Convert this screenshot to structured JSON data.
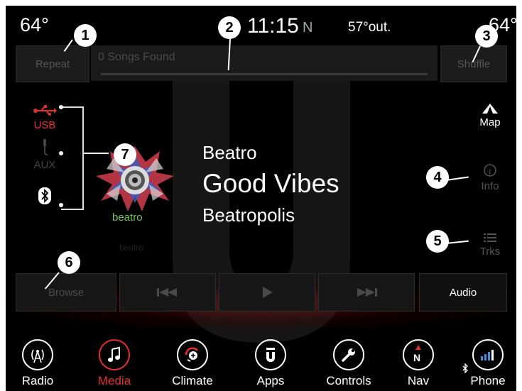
{
  "status": {
    "temp_left": "64°",
    "time": "11:15",
    "compass": "N",
    "outside": "57°out.",
    "temp_right": "64°"
  },
  "top_bar": {
    "repeat": "Repeat",
    "songs_found": "0 Songs Found",
    "shuffle": "Shuffle"
  },
  "sources": {
    "usb": "USB",
    "aux": "AUX"
  },
  "album": {
    "art_label": "beatro",
    "reflection": "beatro"
  },
  "now_playing": {
    "artist": "Beatro",
    "title": "Good Vibes",
    "album": "Beatropolis"
  },
  "side": {
    "map": "Map",
    "info": "Info",
    "tracks": "Trks"
  },
  "controls": {
    "browse": "Browse",
    "audio": "Audio"
  },
  "nav": [
    {
      "label": "Radio"
    },
    {
      "label": "Media"
    },
    {
      "label": "Climate"
    },
    {
      "label": "Apps"
    },
    {
      "label": "Controls"
    },
    {
      "label": "Nav"
    },
    {
      "label": "Phone"
    }
  ],
  "callouts": [
    "1",
    "2",
    "3",
    "4",
    "5",
    "6",
    "7"
  ],
  "colors": {
    "accent": "#e52f2f",
    "background": "#000000",
    "album_green": "#6fc94a"
  }
}
